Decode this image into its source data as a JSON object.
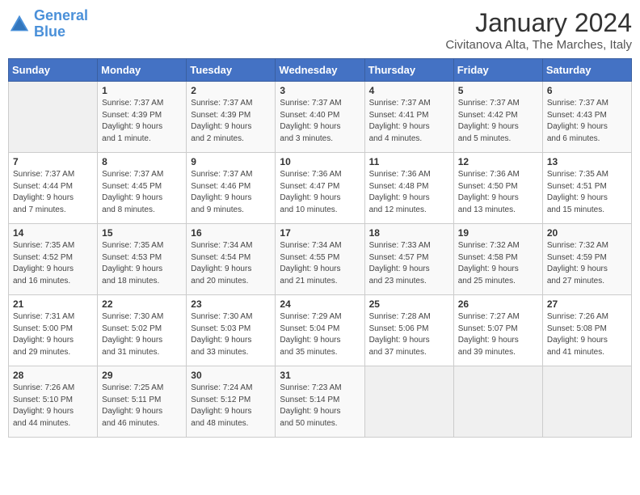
{
  "header": {
    "logo_line1": "General",
    "logo_line2": "Blue",
    "title": "January 2024",
    "subtitle": "Civitanova Alta, The Marches, Italy"
  },
  "days_of_week": [
    "Sunday",
    "Monday",
    "Tuesday",
    "Wednesday",
    "Thursday",
    "Friday",
    "Saturday"
  ],
  "weeks": [
    [
      {
        "day": "",
        "info": ""
      },
      {
        "day": "1",
        "info": "Sunrise: 7:37 AM\nSunset: 4:39 PM\nDaylight: 9 hours\nand 1 minute."
      },
      {
        "day": "2",
        "info": "Sunrise: 7:37 AM\nSunset: 4:39 PM\nDaylight: 9 hours\nand 2 minutes."
      },
      {
        "day": "3",
        "info": "Sunrise: 7:37 AM\nSunset: 4:40 PM\nDaylight: 9 hours\nand 3 minutes."
      },
      {
        "day": "4",
        "info": "Sunrise: 7:37 AM\nSunset: 4:41 PM\nDaylight: 9 hours\nand 4 minutes."
      },
      {
        "day": "5",
        "info": "Sunrise: 7:37 AM\nSunset: 4:42 PM\nDaylight: 9 hours\nand 5 minutes."
      },
      {
        "day": "6",
        "info": "Sunrise: 7:37 AM\nSunset: 4:43 PM\nDaylight: 9 hours\nand 6 minutes."
      }
    ],
    [
      {
        "day": "7",
        "info": "Sunrise: 7:37 AM\nSunset: 4:44 PM\nDaylight: 9 hours\nand 7 minutes."
      },
      {
        "day": "8",
        "info": "Sunrise: 7:37 AM\nSunset: 4:45 PM\nDaylight: 9 hours\nand 8 minutes."
      },
      {
        "day": "9",
        "info": "Sunrise: 7:37 AM\nSunset: 4:46 PM\nDaylight: 9 hours\nand 9 minutes."
      },
      {
        "day": "10",
        "info": "Sunrise: 7:36 AM\nSunset: 4:47 PM\nDaylight: 9 hours\nand 10 minutes."
      },
      {
        "day": "11",
        "info": "Sunrise: 7:36 AM\nSunset: 4:48 PM\nDaylight: 9 hours\nand 12 minutes."
      },
      {
        "day": "12",
        "info": "Sunrise: 7:36 AM\nSunset: 4:50 PM\nDaylight: 9 hours\nand 13 minutes."
      },
      {
        "day": "13",
        "info": "Sunrise: 7:35 AM\nSunset: 4:51 PM\nDaylight: 9 hours\nand 15 minutes."
      }
    ],
    [
      {
        "day": "14",
        "info": "Sunrise: 7:35 AM\nSunset: 4:52 PM\nDaylight: 9 hours\nand 16 minutes."
      },
      {
        "day": "15",
        "info": "Sunrise: 7:35 AM\nSunset: 4:53 PM\nDaylight: 9 hours\nand 18 minutes."
      },
      {
        "day": "16",
        "info": "Sunrise: 7:34 AM\nSunset: 4:54 PM\nDaylight: 9 hours\nand 20 minutes."
      },
      {
        "day": "17",
        "info": "Sunrise: 7:34 AM\nSunset: 4:55 PM\nDaylight: 9 hours\nand 21 minutes."
      },
      {
        "day": "18",
        "info": "Sunrise: 7:33 AM\nSunset: 4:57 PM\nDaylight: 9 hours\nand 23 minutes."
      },
      {
        "day": "19",
        "info": "Sunrise: 7:32 AM\nSunset: 4:58 PM\nDaylight: 9 hours\nand 25 minutes."
      },
      {
        "day": "20",
        "info": "Sunrise: 7:32 AM\nSunset: 4:59 PM\nDaylight: 9 hours\nand 27 minutes."
      }
    ],
    [
      {
        "day": "21",
        "info": "Sunrise: 7:31 AM\nSunset: 5:00 PM\nDaylight: 9 hours\nand 29 minutes."
      },
      {
        "day": "22",
        "info": "Sunrise: 7:30 AM\nSunset: 5:02 PM\nDaylight: 9 hours\nand 31 minutes."
      },
      {
        "day": "23",
        "info": "Sunrise: 7:30 AM\nSunset: 5:03 PM\nDaylight: 9 hours\nand 33 minutes."
      },
      {
        "day": "24",
        "info": "Sunrise: 7:29 AM\nSunset: 5:04 PM\nDaylight: 9 hours\nand 35 minutes."
      },
      {
        "day": "25",
        "info": "Sunrise: 7:28 AM\nSunset: 5:06 PM\nDaylight: 9 hours\nand 37 minutes."
      },
      {
        "day": "26",
        "info": "Sunrise: 7:27 AM\nSunset: 5:07 PM\nDaylight: 9 hours\nand 39 minutes."
      },
      {
        "day": "27",
        "info": "Sunrise: 7:26 AM\nSunset: 5:08 PM\nDaylight: 9 hours\nand 41 minutes."
      }
    ],
    [
      {
        "day": "28",
        "info": "Sunrise: 7:26 AM\nSunset: 5:10 PM\nDaylight: 9 hours\nand 44 minutes."
      },
      {
        "day": "29",
        "info": "Sunrise: 7:25 AM\nSunset: 5:11 PM\nDaylight: 9 hours\nand 46 minutes."
      },
      {
        "day": "30",
        "info": "Sunrise: 7:24 AM\nSunset: 5:12 PM\nDaylight: 9 hours\nand 48 minutes."
      },
      {
        "day": "31",
        "info": "Sunrise: 7:23 AM\nSunset: 5:14 PM\nDaylight: 9 hours\nand 50 minutes."
      },
      {
        "day": "",
        "info": ""
      },
      {
        "day": "",
        "info": ""
      },
      {
        "day": "",
        "info": ""
      }
    ]
  ]
}
